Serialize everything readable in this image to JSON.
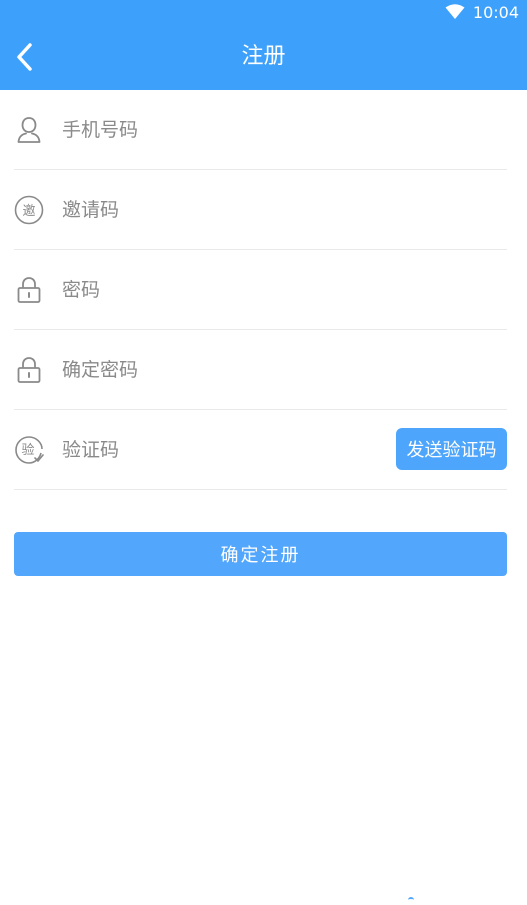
{
  "status_bar": {
    "time": "10:04",
    "wifi_icon": "wifi-icon"
  },
  "nav": {
    "back_icon": "chevron-left-icon",
    "title": "注册"
  },
  "form": {
    "phone": {
      "icon": "user-icon",
      "placeholder": "手机号码"
    },
    "invite": {
      "icon": "invite-icon",
      "icon_glyph": "邀",
      "placeholder": "邀请码"
    },
    "password": {
      "icon": "lock-icon",
      "placeholder": "密码"
    },
    "confirm_password": {
      "icon": "lock-icon",
      "placeholder": "确定密码"
    },
    "verify_code": {
      "icon": "verify-icon",
      "icon_glyph": "验",
      "placeholder": "验证码",
      "send_button": "发送验证码"
    }
  },
  "submit_label": "确定注册",
  "colors": {
    "primary": "#3da1fc",
    "button": "#52a6fb",
    "divider": "#e9e9e9",
    "placeholder": "#8a8a8a"
  }
}
